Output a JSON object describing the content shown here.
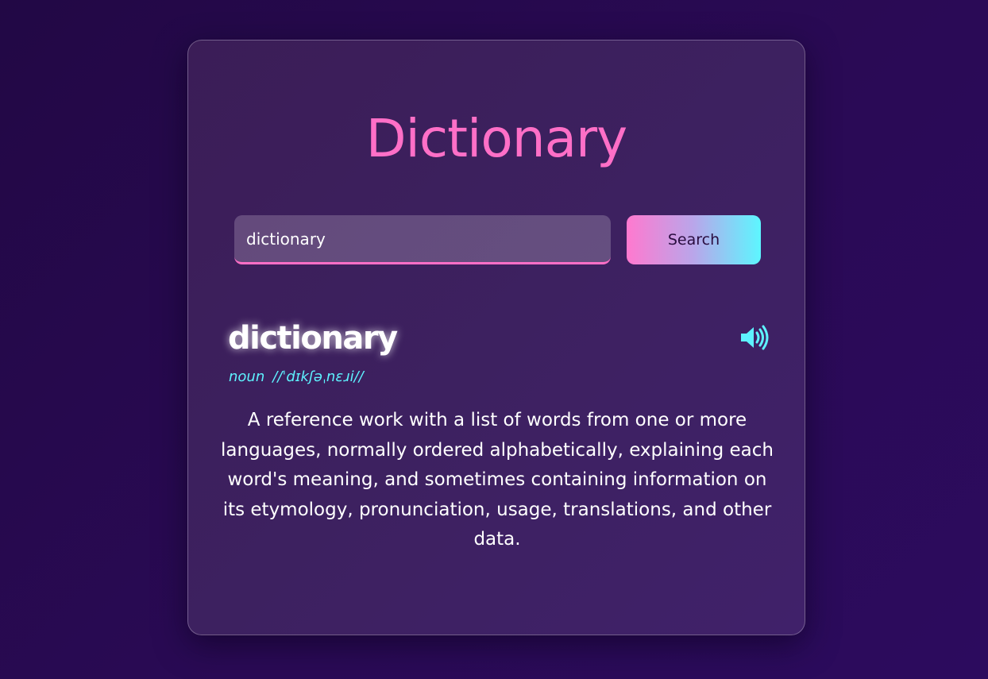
{
  "app": {
    "title": "Dictionary"
  },
  "search": {
    "value": "dictionary",
    "button_label": "Search"
  },
  "result": {
    "word": "dictionary",
    "part_of_speech": "noun",
    "phonetic": "//ˈdɪkʃəˌnɛɹi//",
    "definition": "A reference work with a list of words from one or more languages, normally ordered alphabetically, explaining each word's meaning, and sometimes containing information on its etymology, pronunciation, usage, translations, and other data.",
    "audio_icon": "speaker-icon"
  },
  "colors": {
    "accent_pink": "#ff6fc7",
    "accent_cyan": "#5ef2ff",
    "background": "#250a4f",
    "card": "#3c1f5c"
  }
}
